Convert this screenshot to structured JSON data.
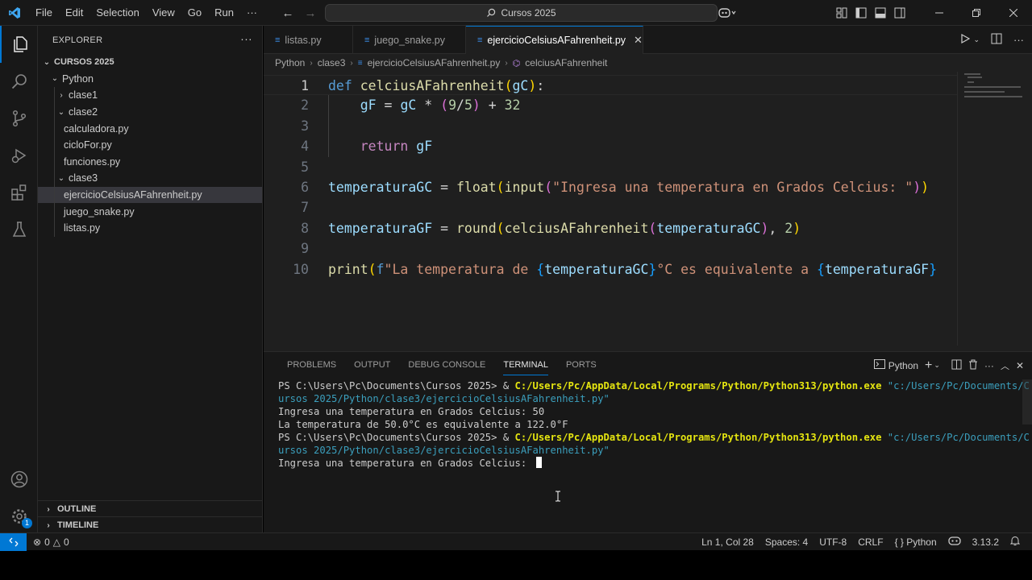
{
  "titlebar": {
    "menu": [
      "File",
      "Edit",
      "Selection",
      "View",
      "Go",
      "Run",
      "···"
    ],
    "search": "Cursos 2025"
  },
  "sidebar": {
    "title": "EXPLORER",
    "more": "···",
    "root": "CURSOS 2025",
    "tree": [
      {
        "label": "Python",
        "type": "folder",
        "open": true,
        "depth": 1
      },
      {
        "label": "clase1",
        "type": "folder",
        "open": false,
        "depth": 2
      },
      {
        "label": "clase2",
        "type": "folder",
        "open": true,
        "depth": 2
      },
      {
        "label": "calculadora.py",
        "type": "file",
        "depth": 3
      },
      {
        "label": "cicloFor.py",
        "type": "file",
        "depth": 3
      },
      {
        "label": "funciones.py",
        "type": "file",
        "depth": 3
      },
      {
        "label": "clase3",
        "type": "folder",
        "open": true,
        "depth": 2
      },
      {
        "label": "ejercicioCelsiusAFahrenheit.py",
        "type": "file",
        "depth": 3,
        "selected": true
      },
      {
        "label": "juego_snake.py",
        "type": "file",
        "depth": 3
      },
      {
        "label": "listas.py",
        "type": "file",
        "depth": 3
      }
    ],
    "outline": "OUTLINE",
    "timeline": "TIMELINE"
  },
  "tabs": [
    {
      "label": "listas.py",
      "active": false
    },
    {
      "label": "juego_snake.py",
      "active": false
    },
    {
      "label": "ejercicioCelsiusAFahrenheit.py",
      "active": true
    }
  ],
  "breadcrumb": [
    "Python",
    "clase3",
    "ejercicioCelsiusAFahrenheit.py",
    "celciusAFahrenheit"
  ],
  "editor": {
    "line_numbers": [
      "1",
      "2",
      "3",
      "4",
      "5",
      "6",
      "7",
      "8",
      "9",
      "10"
    ],
    "lines": [
      [
        [
          "kw",
          "def "
        ],
        [
          "fn",
          "celciusAFahrenheit"
        ],
        [
          "b1",
          "("
        ],
        [
          "var",
          "gC"
        ],
        [
          "b1",
          ")"
        ],
        [
          "pl",
          ":"
        ]
      ],
      [
        [
          "pl",
          "    "
        ],
        [
          "var",
          "gF"
        ],
        [
          "pl",
          " = "
        ],
        [
          "var",
          "gC"
        ],
        [
          "pl",
          " * "
        ],
        [
          "b2",
          "("
        ],
        [
          "num",
          "9"
        ],
        [
          "pl",
          "/"
        ],
        [
          "num",
          "5"
        ],
        [
          "b2",
          ")"
        ],
        [
          "pl",
          " + "
        ],
        [
          "num",
          "32"
        ]
      ],
      [],
      [
        [
          "pl",
          "    "
        ],
        [
          "ctl",
          "return "
        ],
        [
          "var",
          "gF"
        ]
      ],
      [],
      [
        [
          "var",
          "temperaturaGC"
        ],
        [
          "pl",
          " = "
        ],
        [
          "fn",
          "float"
        ],
        [
          "b1",
          "("
        ],
        [
          "fn",
          "input"
        ],
        [
          "b2",
          "("
        ],
        [
          "str",
          "\"Ingresa una temperatura en Grados Celcius: \""
        ],
        [
          "b2",
          ")"
        ],
        [
          "b1",
          ")"
        ]
      ],
      [],
      [
        [
          "var",
          "temperaturaGF"
        ],
        [
          "pl",
          " = "
        ],
        [
          "fn",
          "round"
        ],
        [
          "b1",
          "("
        ],
        [
          "fn",
          "celciusAFahrenheit"
        ],
        [
          "b2",
          "("
        ],
        [
          "var",
          "temperaturaGC"
        ],
        [
          "b2",
          ")"
        ],
        [
          "pl",
          ", "
        ],
        [
          "num",
          "2"
        ],
        [
          "b1",
          ")"
        ]
      ],
      [],
      [
        [
          "fn",
          "print"
        ],
        [
          "b1",
          "("
        ],
        [
          "kw",
          "f"
        ],
        [
          "str",
          "\"La temperatura de "
        ],
        [
          "b3",
          "{"
        ],
        [
          "var",
          "temperaturaGC"
        ],
        [
          "b3",
          "}"
        ],
        [
          "str",
          "°C es equivalente a "
        ],
        [
          "b3",
          "{"
        ],
        [
          "var",
          "temperaturaGF"
        ],
        [
          "b3",
          "}"
        ]
      ]
    ]
  },
  "panel": {
    "tabs": [
      "PROBLEMS",
      "OUTPUT",
      "DEBUG CONSOLE",
      "TERMINAL",
      "PORTS"
    ],
    "active_tab": "TERMINAL",
    "terminal_profile": "Python",
    "terminal": [
      [
        [
          "pl",
          "PS C:\\Users\\Pc\\Documents\\Cursos 2025> & "
        ],
        [
          "yel",
          "C:/Users/Pc/AppData/Local/Programs/Python/Python313/python.exe"
        ],
        [
          "cyan",
          " \"c:/Users/Pc/Documents/C"
        ]
      ],
      [
        [
          "cyan",
          "ursos 2025/Python/clase3/ejercicioCelsiusAFahrenheit.py\""
        ]
      ],
      [
        [
          "pl",
          "Ingresa una temperatura en Grados Celcius: 50"
        ]
      ],
      [
        [
          "pl",
          "La temperatura de 50.0°C es equivalente a 122.0°F"
        ]
      ],
      [
        [
          "pl",
          "PS C:\\Users\\Pc\\Documents\\Cursos 2025> & "
        ],
        [
          "yel",
          "C:/Users/Pc/AppData/Local/Programs/Python/Python313/python.exe"
        ],
        [
          "cyan",
          " \"c:/Users/Pc/Documents/C"
        ]
      ],
      [
        [
          "cyan",
          "ursos 2025/Python/clase3/ejercicioCelsiusAFahrenheit.py\""
        ]
      ],
      [
        [
          "pl",
          "Ingresa una temperatura en Grados Celcius: "
        ]
      ]
    ]
  },
  "statusbar": {
    "problems": "0",
    "warnings": "0",
    "position": "Ln 1, Col 28",
    "spaces": "Spaces: 4",
    "encoding": "UTF-8",
    "eol": "CRLF",
    "language": "Python",
    "python_version": "3.13.2"
  },
  "colors": {
    "accent": "#0078d4",
    "background": "#1f1f1f",
    "sidebar": "#181818"
  }
}
